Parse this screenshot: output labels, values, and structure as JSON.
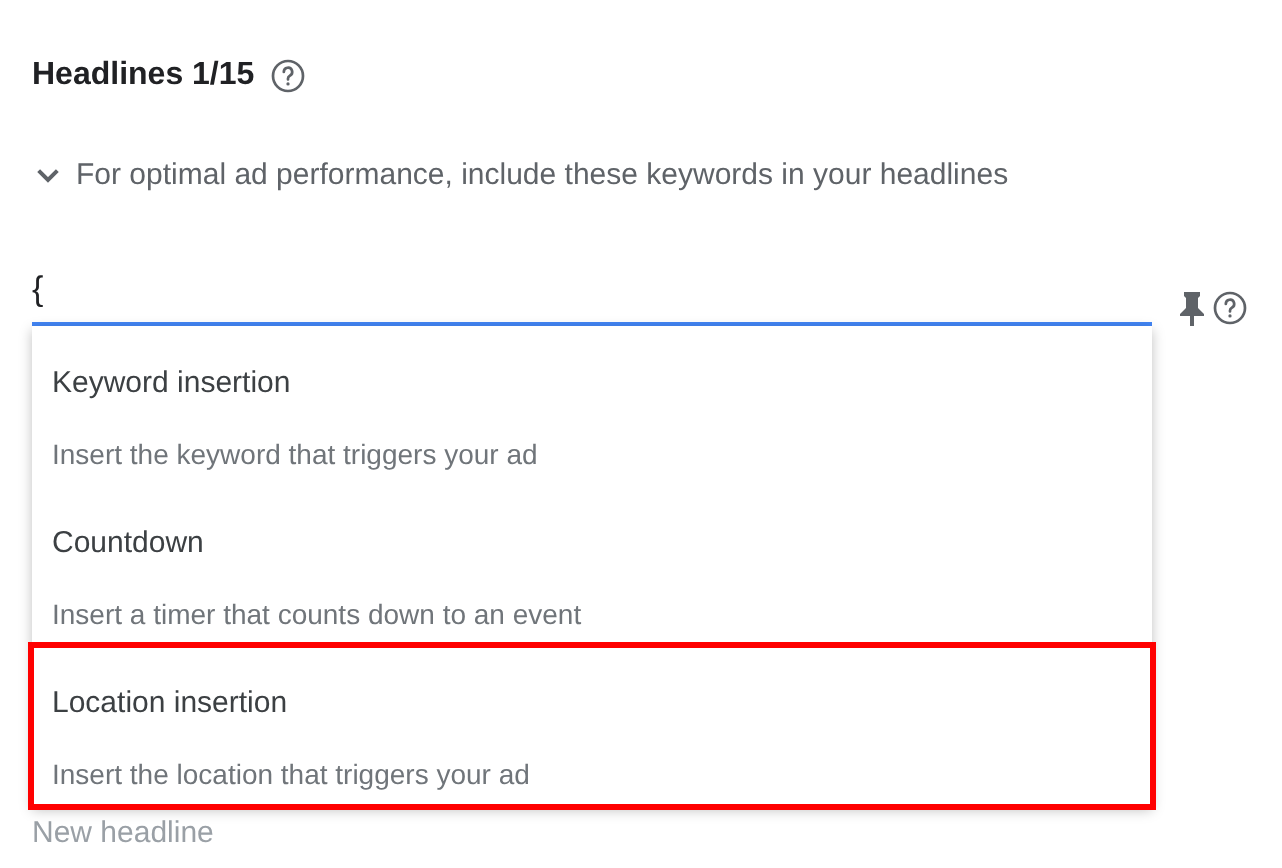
{
  "heading": {
    "title": "Headlines 1/15"
  },
  "hint": {
    "text": "For optimal ad performance, include these keywords in your headlines",
    "expanded": false
  },
  "headline_field": {
    "value": "{",
    "focused": true
  },
  "menu": [
    {
      "title": "Keyword insertion",
      "description": "Insert the keyword that triggers your ad",
      "highlighted": false
    },
    {
      "title": "Countdown",
      "description": "Insert a timer that counts down to an event",
      "highlighted": false
    },
    {
      "title": "Location insertion",
      "description": "Insert the location that triggers your ad",
      "highlighted": true
    }
  ],
  "next_field": {
    "placeholder": "New headline"
  }
}
